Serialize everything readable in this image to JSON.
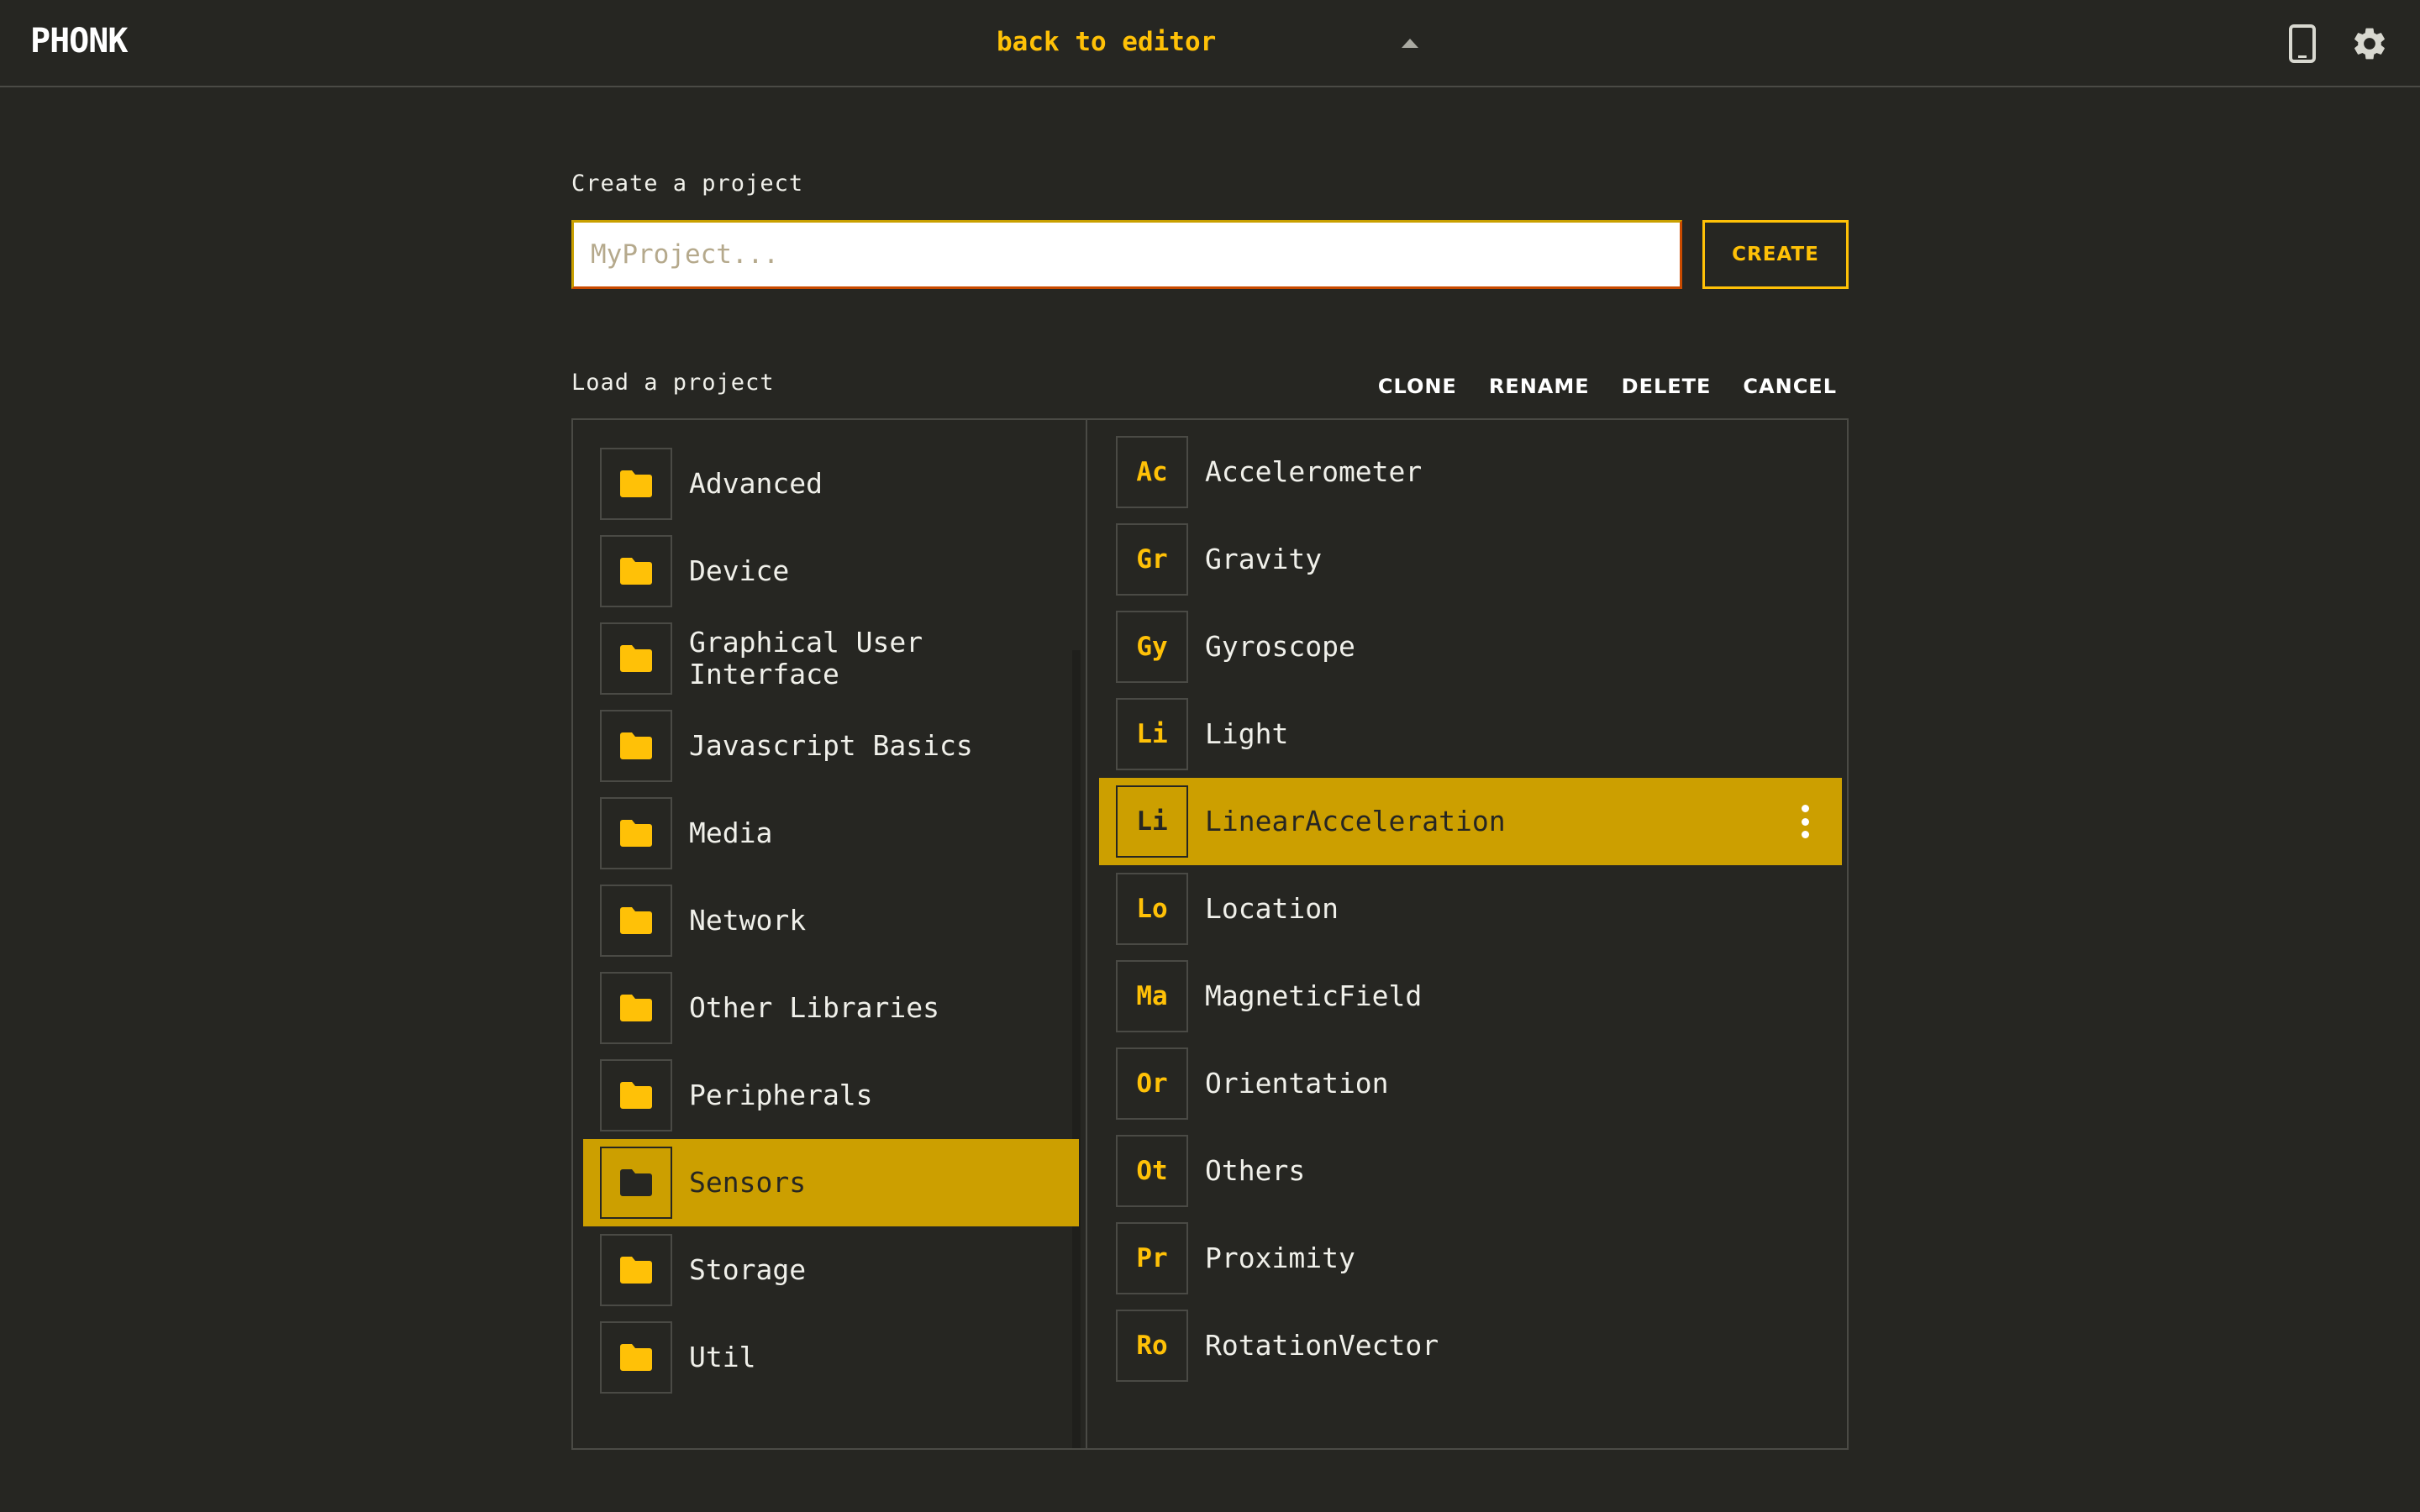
{
  "app": {
    "logo": "PHONK",
    "back_link": "back to editor",
    "icons": [
      "caret-up-icon",
      "phone-icon",
      "gear-icon"
    ]
  },
  "create": {
    "label": "Create a project",
    "input_placeholder": "MyProject...",
    "input_value": "",
    "button_label": "CREATE"
  },
  "load": {
    "label": "Load a project",
    "actions": {
      "clone": "CLONE",
      "rename": "RENAME",
      "delete": "DELETE",
      "cancel": "CANCEL"
    }
  },
  "folders": [
    {
      "label": "Advanced"
    },
    {
      "label": "Device"
    },
    {
      "label": "Graphical User\nInterface"
    },
    {
      "label": "Javascript Basics"
    },
    {
      "label": "Media"
    },
    {
      "label": "Network"
    },
    {
      "label": "Other Libraries"
    },
    {
      "label": "Peripherals"
    },
    {
      "label": "Sensors",
      "selected": true
    },
    {
      "label": "Storage"
    },
    {
      "label": "Util"
    }
  ],
  "projects": [
    {
      "abbr": "Ac",
      "label": "Accelerometer"
    },
    {
      "abbr": "Gr",
      "label": "Gravity"
    },
    {
      "abbr": "Gy",
      "label": "Gyroscope"
    },
    {
      "abbr": "Li",
      "label": "Light"
    },
    {
      "abbr": "Li",
      "label": "LinearAcceleration",
      "selected": true
    },
    {
      "abbr": "Lo",
      "label": "Location"
    },
    {
      "abbr": "Ma",
      "label": "MagneticField"
    },
    {
      "abbr": "Or",
      "label": "Orientation"
    },
    {
      "abbr": "Ot",
      "label": "Others"
    },
    {
      "abbr": "Pr",
      "label": "Proximity"
    },
    {
      "abbr": "Ro",
      "label": "RotationVector"
    }
  ],
  "colors": {
    "background": "#262622",
    "accent": "#ffc107",
    "selected": "#cc9f00",
    "border": "#4a4a45"
  }
}
